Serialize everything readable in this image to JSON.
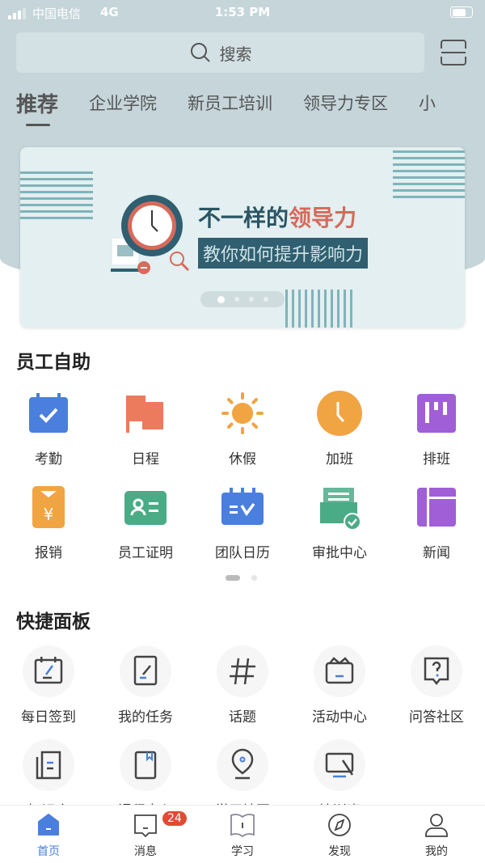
{
  "status_bar": {
    "carrier": "中国电信",
    "network": "4G",
    "time": "1:53 PM"
  },
  "search": {
    "placeholder": "搜索",
    "icon": "search-icon"
  },
  "scan_icon": "scan-icon",
  "tabs": [
    {
      "label": "推荐",
      "active": true
    },
    {
      "label": "企业学院"
    },
    {
      "label": "新员工培训"
    },
    {
      "label": "领导力专区"
    },
    {
      "label": "小"
    }
  ],
  "banner": {
    "title_a": "不一样的",
    "title_b": "领导力",
    "subtitle": "教你如何提升影响力",
    "slides": 4,
    "active_slide": 1,
    "accent": "#d66a5c"
  },
  "self_service": {
    "title": "员工自助",
    "items": [
      {
        "label": "考勤",
        "icon": "calendar-check-icon",
        "color": "#4a7fdd"
      },
      {
        "label": "日程",
        "icon": "flag-icon",
        "color": "#ec7a5c"
      },
      {
        "label": "休假",
        "icon": "sun-icon",
        "color": "#f0a442"
      },
      {
        "label": "加班",
        "icon": "clock-icon",
        "color": "#f0a442"
      },
      {
        "label": "排班",
        "icon": "board-icon",
        "color": "#a05fd6"
      },
      {
        "label": "报销",
        "icon": "yen-receipt-icon",
        "color": "#f0a442"
      },
      {
        "label": "员工证明",
        "icon": "id-card-icon",
        "color": "#4aab87"
      },
      {
        "label": "团队日历",
        "icon": "team-calendar-icon",
        "color": "#4a7fdd"
      },
      {
        "label": "审批中心",
        "icon": "approval-icon",
        "color": "#4aab87"
      },
      {
        "label": "新闻",
        "icon": "news-icon",
        "color": "#a05fd6"
      }
    ],
    "pages": 2,
    "active_page": 1
  },
  "quick_panel": {
    "title": "快捷面板",
    "items": [
      {
        "label": "每日签到",
        "icon": "checkin-icon"
      },
      {
        "label": "我的任务",
        "icon": "task-icon"
      },
      {
        "label": "话题",
        "icon": "hashtag-icon"
      },
      {
        "label": "活动中心",
        "icon": "gift-icon"
      },
      {
        "label": "问答社区",
        "icon": "question-icon"
      },
      {
        "label": "知识库",
        "icon": "knowledge-icon"
      },
      {
        "label": "课程中心",
        "icon": "book-icon"
      },
      {
        "label": "学习地图",
        "icon": "map-pin-icon"
      },
      {
        "label": "培训班",
        "icon": "screen-icon"
      }
    ]
  },
  "tab_bar": [
    {
      "label": "首页",
      "icon": "home-icon",
      "active": true
    },
    {
      "label": "消息",
      "icon": "message-icon",
      "badge": "24"
    },
    {
      "label": "学习",
      "icon": "open-book-icon"
    },
    {
      "label": "发现",
      "icon": "compass-icon"
    },
    {
      "label": "我的",
      "icon": "user-icon"
    }
  ],
  "colors": {
    "header_bg": "#c5d5da",
    "active_tab": "#4a7fdd",
    "badge": "#e24a32"
  }
}
